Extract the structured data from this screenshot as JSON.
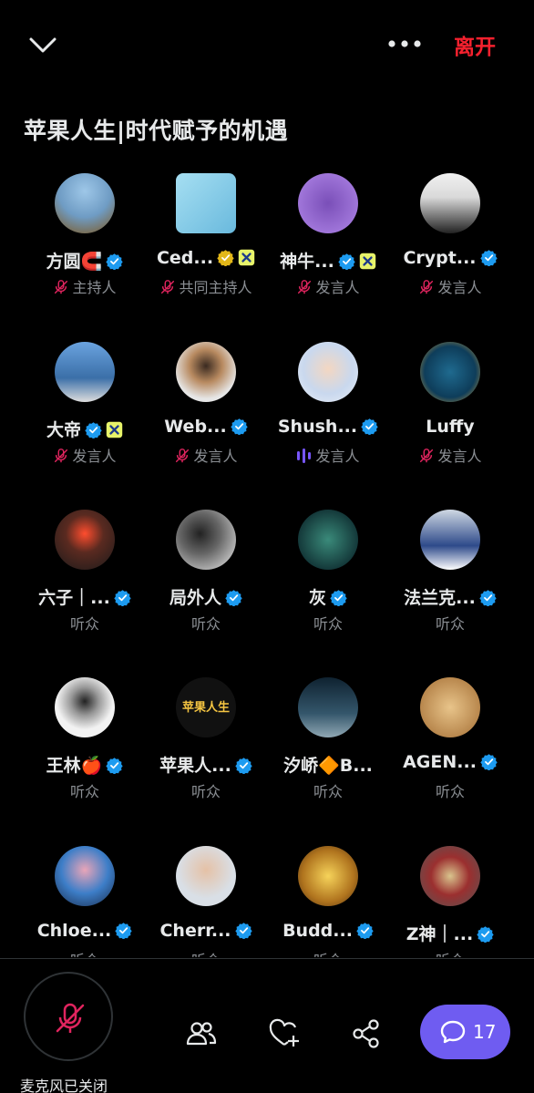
{
  "header": {
    "leave_label": "离开"
  },
  "space": {
    "title": "苹果人生|时代赋予的机遇"
  },
  "participants": [
    {
      "name": "方圆🧲",
      "role": "主持人",
      "verified": true,
      "extra_badge": "",
      "mic": "off"
    },
    {
      "name": "Ced...",
      "role": "共同主持人",
      "verified": "gold",
      "extra_badge": "x",
      "mic": "off"
    },
    {
      "name": "神牛...",
      "role": "发言人",
      "verified": true,
      "extra_badge": "x",
      "mic": "off"
    },
    {
      "name": "Crypt...",
      "role": "发言人",
      "verified": true,
      "extra_badge": "",
      "mic": "off"
    },
    {
      "name": "大帝",
      "role": "发言人",
      "verified": true,
      "extra_badge": "x",
      "mic": "off"
    },
    {
      "name": "Web...",
      "role": "发言人",
      "verified": true,
      "extra_badge": "",
      "mic": "off"
    },
    {
      "name": "Shush...",
      "role": "发言人",
      "verified": true,
      "extra_badge": "",
      "mic": "speaking"
    },
    {
      "name": "Luffy",
      "role": "发言人",
      "verified": false,
      "extra_badge": "",
      "mic": "off"
    },
    {
      "name": "六子｜...",
      "role": "听众",
      "verified": true,
      "extra_badge": "",
      "mic": "none"
    },
    {
      "name": "局外人",
      "role": "听众",
      "verified": true,
      "extra_badge": "",
      "mic": "none"
    },
    {
      "name": "灰",
      "role": "听众",
      "verified": true,
      "extra_badge": "",
      "mic": "none"
    },
    {
      "name": "法兰克...",
      "role": "听众",
      "verified": true,
      "extra_badge": "",
      "mic": "none"
    },
    {
      "name": "王林🍎",
      "role": "听众",
      "verified": true,
      "extra_badge": "",
      "mic": "none"
    },
    {
      "name": "苹果人...",
      "role": "听众",
      "verified": true,
      "extra_badge": "",
      "mic": "none",
      "avatar_text": "苹果人生"
    },
    {
      "name": "汐峤🔶B...",
      "role": "听众",
      "verified": false,
      "extra_badge": "",
      "mic": "none"
    },
    {
      "name": "AGEN...",
      "role": "听众",
      "verified": true,
      "extra_badge": "",
      "mic": "none"
    },
    {
      "name": "Chloe...",
      "role": "听众",
      "verified": true,
      "extra_badge": "",
      "mic": "none"
    },
    {
      "name": "Cherr...",
      "role": "听众",
      "verified": true,
      "extra_badge": "",
      "mic": "none"
    },
    {
      "name": "Budd...",
      "role": "听众",
      "verified": true,
      "extra_badge": "",
      "mic": "none"
    },
    {
      "name": "Z神｜...",
      "role": "听众",
      "verified": true,
      "extra_badge": "",
      "mic": "none"
    }
  ],
  "bottom": {
    "mic_status": "麦克风已关闭",
    "chat_count": "17"
  },
  "colors": {
    "accent": "#6f5cf1",
    "leave": "#f4212e",
    "verified": "#1d9bf0",
    "gold": "#e2b719",
    "mic_off": "#e0245e"
  }
}
